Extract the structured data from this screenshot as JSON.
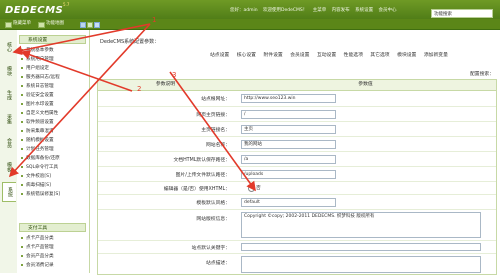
{
  "header": {
    "logo": "DEDECMS",
    "version": "5.7",
    "links": [
      "您好：admin",
      "欢迎使用DedeCMS！",
      "主菜单",
      "内容发布",
      "系统设置",
      "会员中心"
    ],
    "search_value": "功能搜索",
    "subbar": [
      "隐藏菜单",
      "功能地图"
    ]
  },
  "vtabs": [
    "核心",
    "模块",
    "生成",
    "采集",
    "会员",
    "模板",
    "系统"
  ],
  "menu": {
    "sections": [
      {
        "title": "系统设置",
        "items": [
          "系统基本参数",
          "系统用户管理",
          "用户组设定",
          "服务器日志/远程",
          "系统日志管理",
          "验证安全设置",
          "图片水印设置",
          "自定义文档属性",
          "软件频道设置",
          "防采集串混淆",
          "随机模板设置",
          "计划任务管理",
          "数据库备份/还原",
          "SQL命令行工具",
          "文件校验[S]",
          "病毒扫描[S]",
          "系统错误修复[S]"
        ]
      },
      {
        "title": "支付工具",
        "items": [
          "点卡产品分类",
          "点卡产品管理",
          "会员产品分类",
          "会员消费记录"
        ]
      }
    ]
  },
  "main": {
    "title": "DedeCMS系统配置参数：",
    "tabs": [
      "站点设置",
      "核心设置",
      "附件设置",
      "会员设置",
      "互动设置",
      "性能选项",
      "其它选项",
      "模块设置",
      "添加新变量"
    ],
    "config_label": "配置搜索：",
    "table": {
      "headers": [
        "参数说明",
        "参数值"
      ],
      "rows": [
        {
          "label": "站点根网址：",
          "value": "http://www.seo123.win"
        },
        {
          "label": "网页主页链接：",
          "value": "/"
        },
        {
          "label": "主页链接名：",
          "value": "主页"
        },
        {
          "label": "网站名称：",
          "value": "我的网站"
        },
        {
          "label": "文档HTML默认保存路径：",
          "value": "/a"
        },
        {
          "label": "图片/上传文件默认路径：",
          "value": "/uploads"
        },
        {
          "label": "编辑器（是/否）使用XHTML：",
          "value": "否"
        },
        {
          "label": "模板默认风格：",
          "value": "default"
        },
        {
          "label": "网站版权信息：",
          "value": "Copyright ©copy; 2002-2011 DEDECMS. 织梦科技 版权所有"
        },
        {
          "label": "站点默认关键字：",
          "value": ""
        },
        {
          "label": "站点描述：",
          "value": ""
        }
      ]
    }
  },
  "annotations": [
    "1",
    "2",
    "3"
  ]
}
